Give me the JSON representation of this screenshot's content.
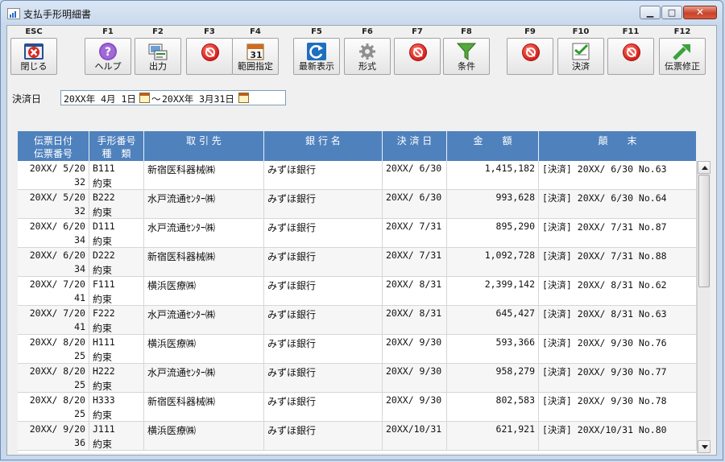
{
  "window": {
    "title": "支払手形明細書",
    "controls": {
      "minimize": "▁",
      "maximize": "□",
      "close": "✕"
    }
  },
  "toolbar": [
    {
      "key": "ESC",
      "label": "閉じる",
      "icon": "close-window-icon"
    },
    {
      "key": "F1",
      "label": "ヘルプ",
      "icon": "help-icon"
    },
    {
      "key": "F2",
      "label": "出力",
      "icon": "output-icon"
    },
    {
      "key": "F3",
      "label": "",
      "icon": "disabled-icon"
    },
    {
      "key": "F4",
      "label": "範囲指定",
      "icon": "calendar-icon",
      "badge": "31"
    },
    {
      "key": "F5",
      "label": "最新表示",
      "icon": "refresh-icon"
    },
    {
      "key": "F6",
      "label": "形式",
      "icon": "gear-icon"
    },
    {
      "key": "F7",
      "label": "",
      "icon": "disabled-icon"
    },
    {
      "key": "F8",
      "label": "条件",
      "icon": "filter-icon"
    },
    {
      "key": "F9",
      "label": "",
      "icon": "disabled-icon"
    },
    {
      "key": "F10",
      "label": "決済",
      "icon": "settle-check-icon"
    },
    {
      "key": "F11",
      "label": "",
      "icon": "disabled-icon"
    },
    {
      "key": "F12",
      "label": "伝票修正",
      "icon": "edit-arrow-icon"
    }
  ],
  "filter": {
    "label": "決済日",
    "from": "20XX年 4月 1日",
    "separator": "～",
    "to": "20XX年 3月31日"
  },
  "table": {
    "headers": [
      {
        "l1": "伝票日付",
        "l2": "伝票番号"
      },
      {
        "l1": "手形番号",
        "l2": "種　類"
      },
      {
        "l1": "取 引 先",
        "l2": ""
      },
      {
        "l1": "銀 行 名",
        "l2": ""
      },
      {
        "l1": "決 済 日",
        "l2": ""
      },
      {
        "l1": "金　　額",
        "l2": ""
      },
      {
        "l1": "顛　　末",
        "l2": ""
      }
    ],
    "rows": [
      {
        "date": "20XX/ 5/20",
        "slip": "32",
        "note_no": "B111",
        "kind": "約束",
        "partner": "新宿医科器械㈱",
        "bank": "みずほ銀行",
        "settle": "20XX/ 6/30",
        "amount": "1,415,182",
        "result": "[決済] 20XX/ 6/30 No.63"
      },
      {
        "date": "20XX/ 5/20",
        "slip": "32",
        "note_no": "B222",
        "kind": "約束",
        "partner": "水戸流通ｾﾝﾀｰ㈱",
        "bank": "みずほ銀行",
        "settle": "20XX/ 6/30",
        "amount": "993,628",
        "result": "[決済] 20XX/ 6/30 No.64"
      },
      {
        "date": "20XX/ 6/20",
        "slip": "34",
        "note_no": "D111",
        "kind": "約束",
        "partner": "水戸流通ｾﾝﾀｰ㈱",
        "bank": "みずほ銀行",
        "settle": "20XX/ 7/31",
        "amount": "895,290",
        "result": "[決済] 20XX/ 7/31 No.87"
      },
      {
        "date": "20XX/ 6/20",
        "slip": "34",
        "note_no": "D222",
        "kind": "約束",
        "partner": "新宿医科器械㈱",
        "bank": "みずほ銀行",
        "settle": "20XX/ 7/31",
        "amount": "1,092,728",
        "result": "[決済] 20XX/ 7/31 No.88"
      },
      {
        "date": "20XX/ 7/20",
        "slip": "41",
        "note_no": "F111",
        "kind": "約束",
        "partner": "横浜医療㈱",
        "bank": "みずほ銀行",
        "settle": "20XX/ 8/31",
        "amount": "2,399,142",
        "result": "[決済] 20XX/ 8/31 No.62"
      },
      {
        "date": "20XX/ 7/20",
        "slip": "41",
        "note_no": "F222",
        "kind": "約束",
        "partner": "水戸流通ｾﾝﾀｰ㈱",
        "bank": "みずほ銀行",
        "settle": "20XX/ 8/31",
        "amount": "645,427",
        "result": "[決済] 20XX/ 8/31 No.63"
      },
      {
        "date": "20XX/ 8/20",
        "slip": "25",
        "note_no": "H111",
        "kind": "約束",
        "partner": "横浜医療㈱",
        "bank": "みずほ銀行",
        "settle": "20XX/ 9/30",
        "amount": "593,366",
        "result": "[決済] 20XX/ 9/30 No.76"
      },
      {
        "date": "20XX/ 8/20",
        "slip": "25",
        "note_no": "H222",
        "kind": "約束",
        "partner": "水戸流通ｾﾝﾀｰ㈱",
        "bank": "みずほ銀行",
        "settle": "20XX/ 9/30",
        "amount": "958,279",
        "result": "[決済] 20XX/ 9/30 No.77"
      },
      {
        "date": "20XX/ 8/20",
        "slip": "25",
        "note_no": "H333",
        "kind": "約束",
        "partner": "新宿医科器械㈱",
        "bank": "みずほ銀行",
        "settle": "20XX/ 9/30",
        "amount": "802,583",
        "result": "[決済] 20XX/ 9/30 No.78"
      },
      {
        "date": "20XX/ 9/20",
        "slip": "36",
        "note_no": "J111",
        "kind": "約束",
        "partner": "横浜医療㈱",
        "bank": "みずほ銀行",
        "settle": "20XX/10/31",
        "amount": "621,921",
        "result": "[決済] 20XX/10/31 No.80"
      }
    ]
  },
  "colors": {
    "header_bg": "#4f81bd",
    "row_alt": "#f6f6f6"
  }
}
